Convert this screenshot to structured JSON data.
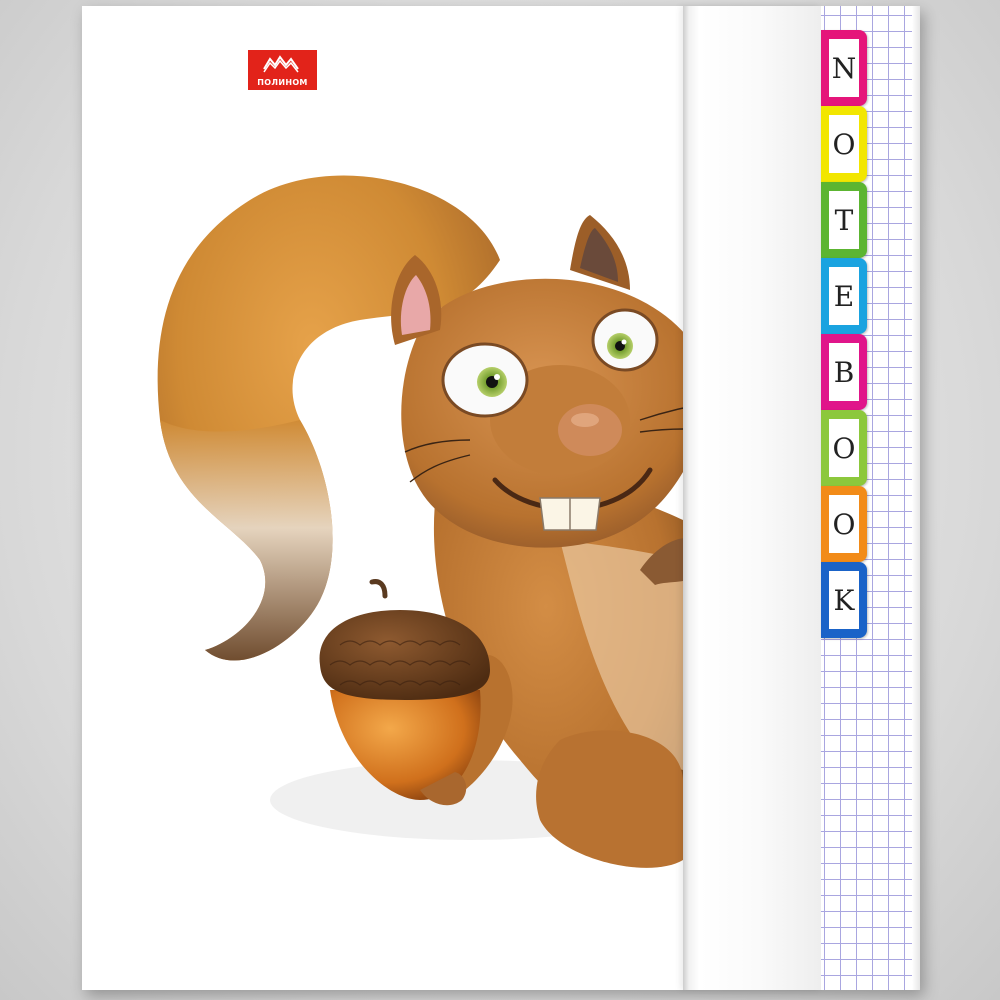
{
  "brand": {
    "logo_text": "ПОЛИНОМ",
    "logo_color": "#e2231a"
  },
  "tabs": [
    {
      "letter": "N",
      "color": "#e5157a"
    },
    {
      "letter": "O",
      "color": "#f2e600"
    },
    {
      "letter": "T",
      "color": "#5cb531"
    },
    {
      "letter": "E",
      "color": "#1aa3e0"
    },
    {
      "letter": "B",
      "color": "#e0158a"
    },
    {
      "letter": "O",
      "color": "#8cc83c"
    },
    {
      "letter": "O",
      "color": "#f28b18"
    },
    {
      "letter": "K",
      "color": "#1a63c8"
    }
  ],
  "illustration": {
    "subject": "cartoon squirrel holding an acorn",
    "fur_color": "#c97c2c",
    "acorn_cap_color": "#6b3f1c",
    "acorn_nut_color": "#d87a1f"
  },
  "grid_line_color": "#a9a6e0"
}
